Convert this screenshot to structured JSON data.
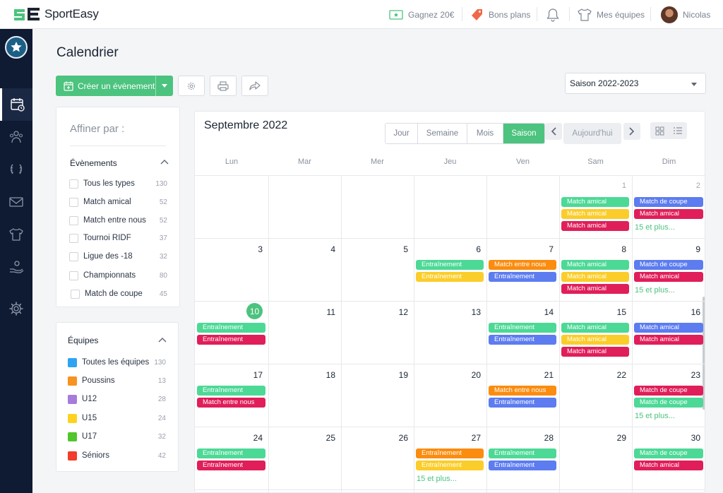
{
  "header": {
    "brand": "SportEasy",
    "earn": "Gagnez 20€",
    "deals": "Bons plans",
    "teams": "Mes équipes",
    "user": "Nicolas"
  },
  "page": {
    "title": "Calendrier",
    "create_label": "Créer un évènement",
    "season": "Saison 2022-2023"
  },
  "filters": {
    "title": "Affiner par :",
    "events_title": "Évènements",
    "events": [
      {
        "label": "Tous les types",
        "count": "130"
      },
      {
        "label": "Match amical",
        "count": "52"
      },
      {
        "label": "Match entre nous",
        "count": "52"
      },
      {
        "label": "Tournoi RIDF",
        "count": "37"
      },
      {
        "label": "Ligue des -18",
        "count": "32"
      },
      {
        "label": "Championnats",
        "count": "80"
      },
      {
        "label": "Match de coupe",
        "count": "45"
      }
    ],
    "teams_title": "Équipes",
    "teams": [
      {
        "label": "Toutes les équipes",
        "count": "130",
        "color": "#2ea3f2"
      },
      {
        "label": "Poussins",
        "count": "13",
        "color": "#f7931e"
      },
      {
        "label": "U12",
        "count": "28",
        "color": "#a77bdb"
      },
      {
        "label": "U15",
        "count": "24",
        "color": "#ffd21f"
      },
      {
        "label": "U17",
        "count": "32",
        "color": "#51c52b"
      },
      {
        "label": "Séniors",
        "count": "42",
        "color": "#f23c2c"
      }
    ]
  },
  "calendar": {
    "month": "Septembre 2022",
    "views": [
      "Jour",
      "Semaine",
      "Mois",
      "Saison"
    ],
    "active_view": "Saison",
    "today_label": "Aujourd'hui",
    "days": [
      "Lun",
      "Mar",
      "Mer",
      "Jeu",
      "Ven",
      "Sam",
      "Dim"
    ],
    "colors": {
      "green": "#4cd996",
      "yellow": "#fbcd2a",
      "red": "#e01e5a",
      "blue": "#5c7cf0",
      "orange": "#fb8c0f",
      "accent": "#4cc37e"
    },
    "weeks": [
      [
        {
          "num": "",
          "events": []
        },
        {
          "num": "",
          "events": []
        },
        {
          "num": "",
          "events": []
        },
        {
          "num": "",
          "events": []
        },
        {
          "num": "",
          "events": []
        },
        {
          "num": "1",
          "muted": true,
          "events": [
            {
              "label": "Match amical",
              "color": "green"
            },
            {
              "label": "Match amical",
              "color": "yellow"
            },
            {
              "label": "Match amical",
              "color": "red"
            }
          ]
        },
        {
          "num": "2",
          "muted": true,
          "events": [
            {
              "label": "Match de coupe",
              "color": "blue"
            },
            {
              "label": "Match amical",
              "color": "red"
            }
          ],
          "more": "15 et plus..."
        }
      ],
      [
        {
          "num": "3",
          "events": []
        },
        {
          "num": "4",
          "events": []
        },
        {
          "num": "5",
          "events": []
        },
        {
          "num": "6",
          "events": [
            {
              "label": "Entraînement",
              "color": "green"
            },
            {
              "label": "Entraînement",
              "color": "yellow"
            }
          ]
        },
        {
          "num": "7",
          "events": [
            {
              "label": "Match entre nous",
              "color": "orange"
            },
            {
              "label": "Entraînement",
              "color": "blue"
            }
          ]
        },
        {
          "num": "8",
          "events": [
            {
              "label": "Match amical",
              "color": "green"
            },
            {
              "label": "Match amical",
              "color": "yellow"
            },
            {
              "label": "Match amical",
              "color": "red"
            }
          ]
        },
        {
          "num": "9",
          "events": [
            {
              "label": "Match de coupe",
              "color": "blue"
            },
            {
              "label": "Match amical",
              "color": "red"
            }
          ],
          "more": "15 et plus..."
        }
      ],
      [
        {
          "num": "10",
          "today": true,
          "events": [
            {
              "label": "Entraînement",
              "color": "green"
            },
            {
              "label": "Entraînement",
              "color": "red"
            }
          ]
        },
        {
          "num": "11",
          "events": []
        },
        {
          "num": "12",
          "events": []
        },
        {
          "num": "13",
          "events": []
        },
        {
          "num": "14",
          "events": [
            {
              "label": "Entraînement",
              "color": "green"
            },
            {
              "label": "Entraînement",
              "color": "blue"
            }
          ]
        },
        {
          "num": "15",
          "events": [
            {
              "label": "Match amical",
              "color": "green"
            },
            {
              "label": "Match amical",
              "color": "yellow"
            },
            {
              "label": "Match amical",
              "color": "red"
            }
          ]
        },
        {
          "num": "16",
          "events": [
            {
              "label": "Match amical",
              "color": "blue"
            },
            {
              "label": "Match amical",
              "color": "red"
            }
          ]
        }
      ],
      [
        {
          "num": "17",
          "events": [
            {
              "label": "Entraînement",
              "color": "green"
            },
            {
              "label": "Match entre nous",
              "color": "red"
            }
          ]
        },
        {
          "num": "18",
          "events": []
        },
        {
          "num": "19",
          "events": []
        },
        {
          "num": "20",
          "events": []
        },
        {
          "num": "21",
          "events": [
            {
              "label": "Match entre nous",
              "color": "orange"
            },
            {
              "label": "Entraînement",
              "color": "blue"
            }
          ]
        },
        {
          "num": "22",
          "events": []
        },
        {
          "num": "23",
          "events": [
            {
              "label": "Match de coupe",
              "color": "red"
            },
            {
              "label": "Match de coupe",
              "color": "green"
            }
          ],
          "more": "15 et plus..."
        }
      ],
      [
        {
          "num": "24",
          "events": [
            {
              "label": "Entraînement",
              "color": "green"
            },
            {
              "label": "Entraînement",
              "color": "red"
            }
          ]
        },
        {
          "num": "25",
          "events": []
        },
        {
          "num": "26",
          "events": []
        },
        {
          "num": "27",
          "events": [
            {
              "label": "Entraînement",
              "color": "orange"
            },
            {
              "label": "Entraînement",
              "color": "yellow"
            }
          ],
          "more": "15 et plus..."
        },
        {
          "num": "28",
          "events": [
            {
              "label": "Entraînement",
              "color": "green"
            },
            {
              "label": "Entraînement",
              "color": "blue"
            }
          ]
        },
        {
          "num": "29",
          "events": []
        },
        {
          "num": "30",
          "events": [
            {
              "label": "Match de coupe",
              "color": "green"
            },
            {
              "label": "Match amical",
              "color": "red"
            }
          ]
        }
      ]
    ]
  }
}
